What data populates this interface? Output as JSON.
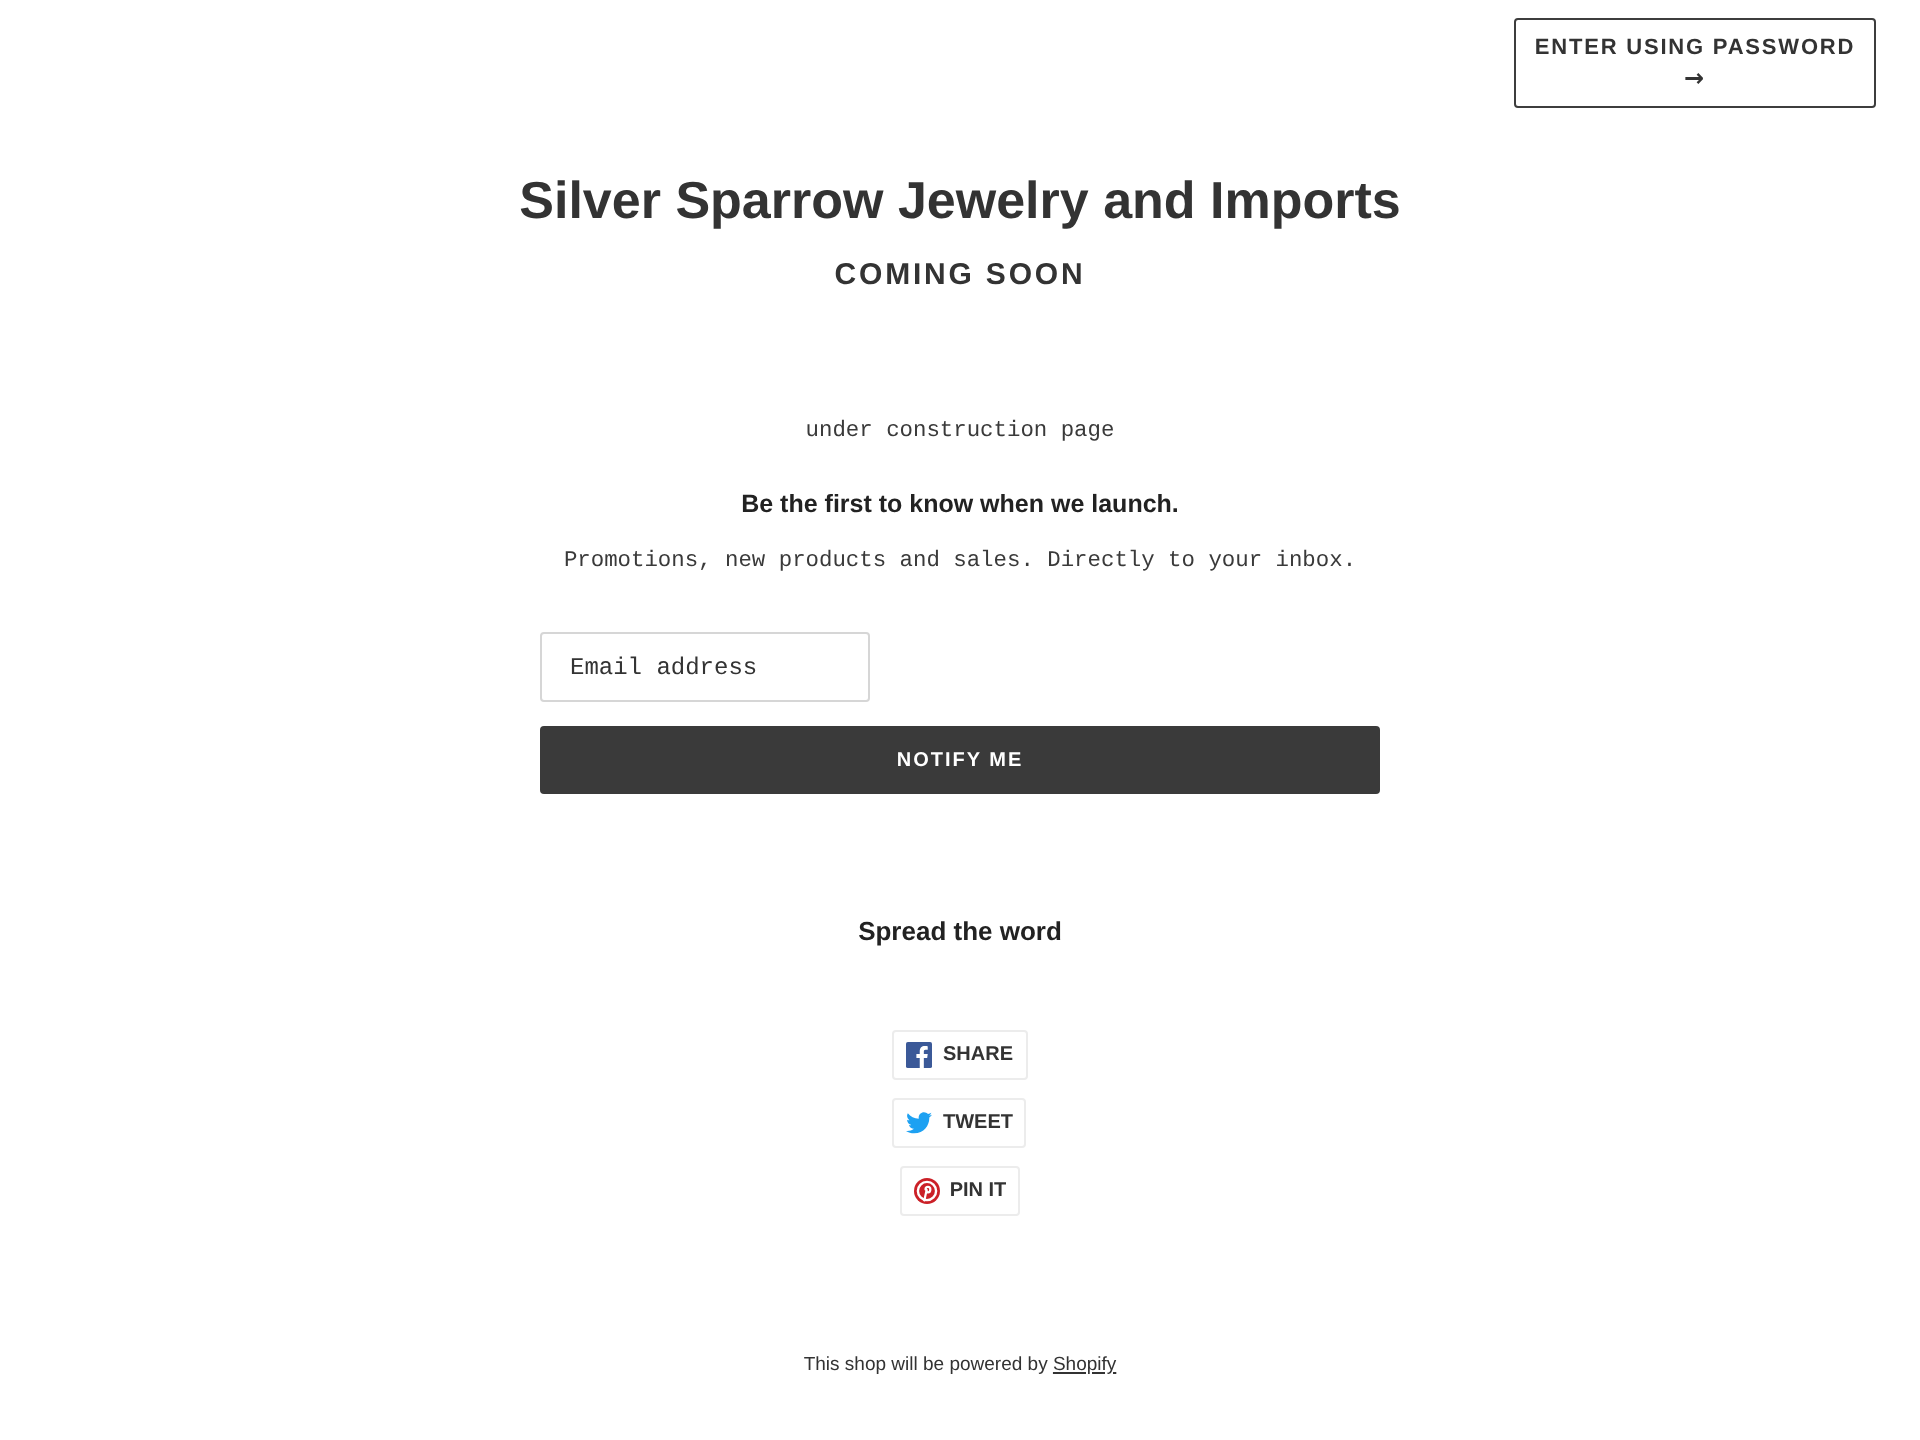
{
  "header": {
    "password_button": {
      "label": "ENTER USING PASSWORD",
      "arrow": "→"
    }
  },
  "hero": {
    "title": "Silver Sparrow Jewelry and Imports",
    "subtitle": "COMING SOON"
  },
  "content": {
    "message": "under construction page",
    "heading": "Be the first to know when we launch.",
    "text": "Promotions, new products and sales. Directly to your inbox."
  },
  "signup": {
    "email": {
      "placeholder": "Email address"
    },
    "button": "NOTIFY ME"
  },
  "share": {
    "heading": "Spread the word",
    "buttons": [
      {
        "kind": "facebook",
        "label": "SHARE"
      },
      {
        "kind": "twitter",
        "label": "TWEET"
      },
      {
        "kind": "pinterest",
        "label": "PIN IT"
      }
    ]
  },
  "footer": {
    "text": "This shop will be powered by",
    "link": "Shopify"
  }
}
